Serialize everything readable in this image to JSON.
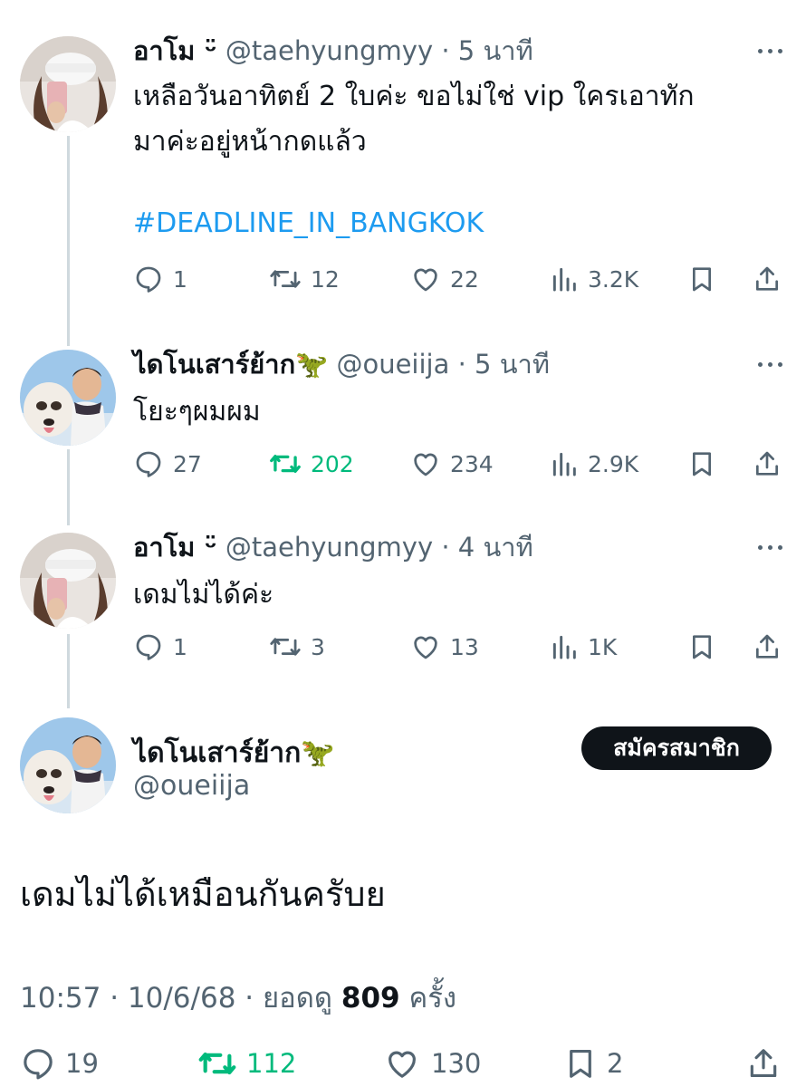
{
  "tweets": [
    {
      "name": "อาโม ᵕ̈",
      "handle": "@taehyungmyy",
      "sep": "·",
      "time": "5 นาที",
      "text_lines": [
        "เหลือวันอาทิตย์ 2 ใบค่ะ ขอไม่ใช่ vip ใครเอาทัก",
        "มาค่ะอยู่หน้ากดแล้ว"
      ],
      "hashtag": "#DEADLINE_IN_BANGKOK",
      "replies": "1",
      "retweets": "12",
      "likes": "22",
      "views": "3.2K",
      "retweeted": false,
      "avatar_icon": "avatar-girl-cap"
    },
    {
      "name": "ไดโนเสาร์ย้าก",
      "name_emoji": "🦖",
      "handle": "@oueiija",
      "sep": "·",
      "time": "5 นาที",
      "text_lines": [
        "โยะๆผมผม"
      ],
      "replies": "27",
      "retweets": "202",
      "likes": "234",
      "views": "2.9K",
      "retweeted": true,
      "avatar_icon": "avatar-boy-dog"
    },
    {
      "name": "อาโม ᵕ̈",
      "handle": "@taehyungmyy",
      "sep": "·",
      "time": "4 นาที",
      "text_lines": [
        "เดมไม่ได้ค่ะ"
      ],
      "replies": "1",
      "retweets": "3",
      "likes": "13",
      "views": "1K",
      "retweeted": false,
      "avatar_icon": "avatar-girl-cap"
    }
  ],
  "main_tweet": {
    "name": "ไดโนเสาร์ย้าก",
    "name_emoji": "🦖",
    "handle": "@oueiija",
    "subscribe_label": "สมัครสมาชิก",
    "text": "เดมไม่ได้เหมือนกันครับย",
    "time": "10:57",
    "date": "10/6/68",
    "views_label": "ยอดดู",
    "views_count": "809",
    "views_suffix": "ครั้ง",
    "replies": "19",
    "retweets": "112",
    "likes": "130",
    "bookmarks": "2",
    "retweeted": true
  },
  "colors": {
    "text": "#0f1419",
    "muted": "#536471",
    "link": "#1d9bf0",
    "retweet_active": "#00ba7c",
    "thread_line": "#cfd9de"
  }
}
